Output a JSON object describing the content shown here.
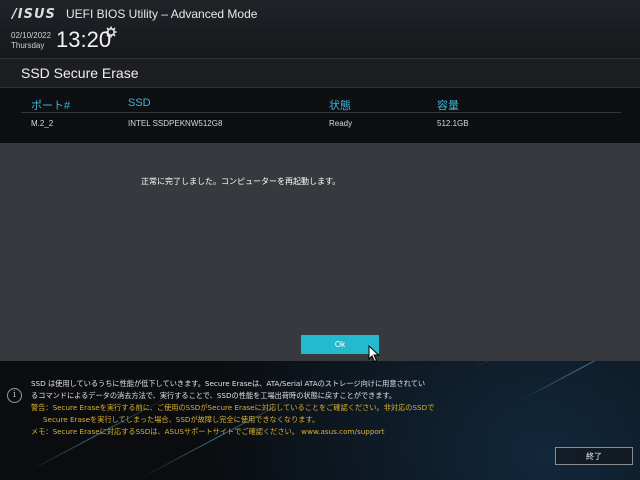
{
  "header": {
    "brand": "/ISUS",
    "app_title": "UEFI BIOS Utility – Advanced Mode",
    "date": "02/10/2022",
    "day": "Thursday",
    "time": "13:20",
    "settings_icon": "gear-icon"
  },
  "page": {
    "title": "SSD Secure Erase"
  },
  "table": {
    "headers": [
      "ポート#",
      "SSD",
      "状態",
      "容量"
    ],
    "rows": [
      [
        "M.2_2",
        "INTEL SSDPEKNW512G8",
        "Ready",
        "512.1GB"
      ]
    ]
  },
  "dialog": {
    "message": "正常に完了しました。コンピューターを再起動します。",
    "ok_label": "Ok"
  },
  "info": {
    "icon": "info-icon",
    "lines": [
      "SSD は使用しているうちに性能が低下していきます。Secure Eraseは、ATA/Serial ATAのストレージ向けに用意されてい",
      "るコマンドによるデータの消去方法で、実行することで、SSDの性能を工場出荷時の状態に戻すことができます。",
      "警告：Secure Eraseを実行する前に、ご使用のSSDがSecure Eraseに対応していることをご確認ください。非対応のSSDで",
      "Secure Eraseを実行してしまった場合、SSDが故障し完全に使用できなくなります。",
      "メモ：Secure Eraseに対応するSSDは、ASUSサポートサイトでご確認ください。 www.asus.com/support"
    ]
  },
  "footer": {
    "exit_label": "終了"
  },
  "colors": {
    "accent": "#25b9cf",
    "header_text": "#3bb7d6",
    "warning_text": "#d9b232"
  }
}
